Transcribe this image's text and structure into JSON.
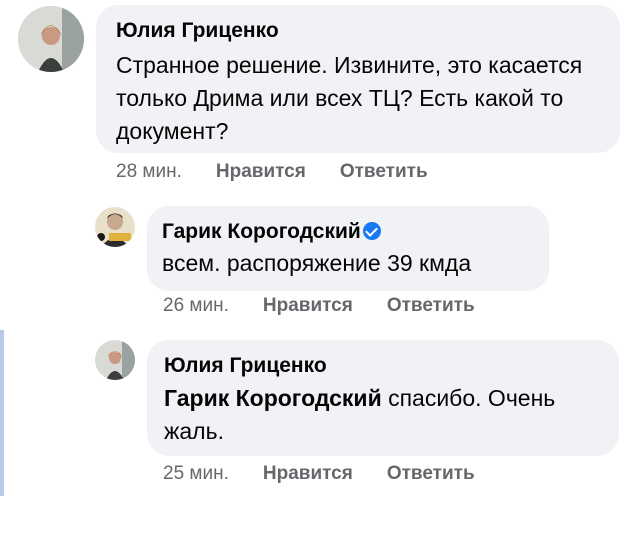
{
  "comments": [
    {
      "author": "Юлия Гриценко",
      "text": "Странное решение. Извините, это касается только Дрима или всех ТЦ? Есть какой то документ?",
      "time": "28 мин.",
      "like": "Нравится",
      "reply": "Ответить"
    },
    {
      "author": "Гарик Корогодский",
      "verified": true,
      "text": "всем. распоряжение 39 кмда",
      "time": "26 мин.",
      "like": "Нравится",
      "reply": "Ответить"
    },
    {
      "author": "Юлия Гриценко",
      "mention": "Гарик Корогодский",
      "text": " спасибо. Очень жаль.",
      "time": "25 мин.",
      "like": "Нравится",
      "reply": "Ответить"
    }
  ],
  "colors": {
    "bubble": "#f0f2f5",
    "meta": "#65676b",
    "verified": "#1877f2",
    "highlight": "#b8c9ea"
  }
}
